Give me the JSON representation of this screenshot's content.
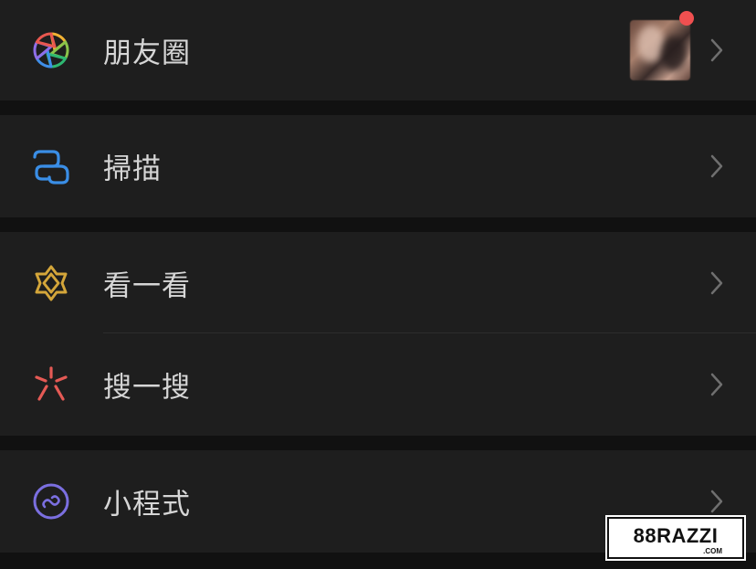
{
  "menu": {
    "moments": {
      "label": "朋友圈",
      "icon": "moments-aperture-icon",
      "has_badge": true
    },
    "scan": {
      "label": "掃描",
      "icon": "scan-icon"
    },
    "top_stories": {
      "label": "看一看",
      "icon": "top-stories-icon"
    },
    "search": {
      "label": "搜一搜",
      "icon": "search-icon"
    },
    "mini_programs": {
      "label": "小程式",
      "icon": "mini-program-icon"
    }
  },
  "watermark": {
    "main": "88RAZZI",
    "sub": ".COM"
  },
  "colors": {
    "background": "#111111",
    "row": "#1e1e1e",
    "text": "#d6d6d6",
    "chevron": "#6f6f6f",
    "badge": "#f05050",
    "scan": "#3a8ee6",
    "top_stories": "#d4a63a",
    "search": "#e55a55",
    "mini_program": "#7b6fe0"
  }
}
